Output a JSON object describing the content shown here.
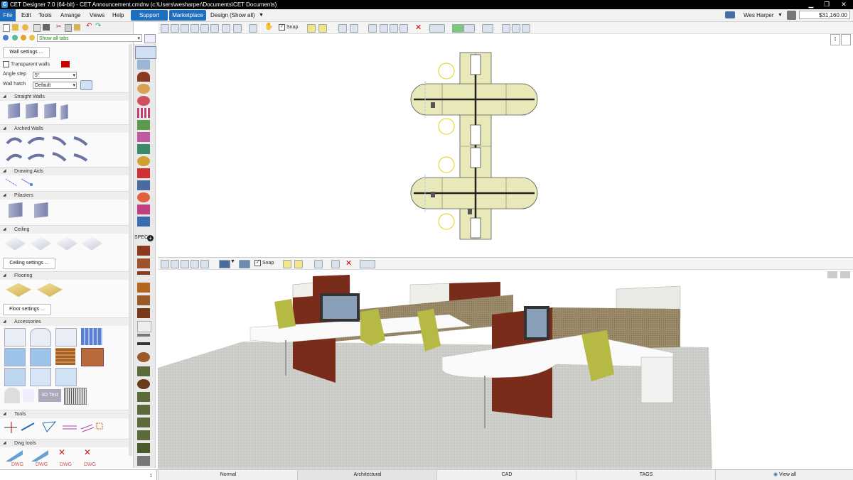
{
  "window": {
    "title": "CET Designer 7.0 (64-bit) - CET Announcement.cmdrw (c:\\Users\\wesharper\\Documents\\CET Documents)",
    "logo_text": "C"
  },
  "menu": {
    "items": [
      "File",
      "Edit",
      "Tools",
      "Arrange",
      "Views",
      "Help"
    ],
    "support": "Support",
    "marketplace": "Marketplace",
    "design": "Design (Show all)",
    "user": "Wes Harper",
    "price": "$31,160.00"
  },
  "left": {
    "show_tabs": "Show all tabs",
    "wall_settings": "Wall settings ...",
    "transparent_walls": "Transparent walls",
    "angle_step_label": "Angle step",
    "angle_step_value": "5°",
    "wall_hatch_label": "Wall hatch",
    "wall_hatch_value": "Default",
    "sections": [
      "Straight Walls",
      "Arched Walls",
      "Drawing Aids",
      "Pilasters",
      "Ceiling",
      "Flooring",
      "Accessories",
      "Tools",
      "Dwg tools"
    ],
    "ceiling_settings": "Ceiling settings ...",
    "floor_settings": "Floor settings ...",
    "text3d": "3D Text",
    "dwg": [
      "DWG",
      "DWG",
      "DWG",
      "DWG"
    ],
    "spec": "SPEC"
  },
  "toolbar": {
    "snap": "Snap"
  },
  "status": {
    "tabs": [
      "Normal",
      "Architectural",
      "CAD",
      "TAGS"
    ],
    "view_all": "View all"
  },
  "colors": {
    "accent": "#1e6fbf",
    "plan_fill": "#e9e8b8",
    "swatch": "#cc0000",
    "chair": "#c2c24a",
    "wood": "#8c3a1e"
  }
}
